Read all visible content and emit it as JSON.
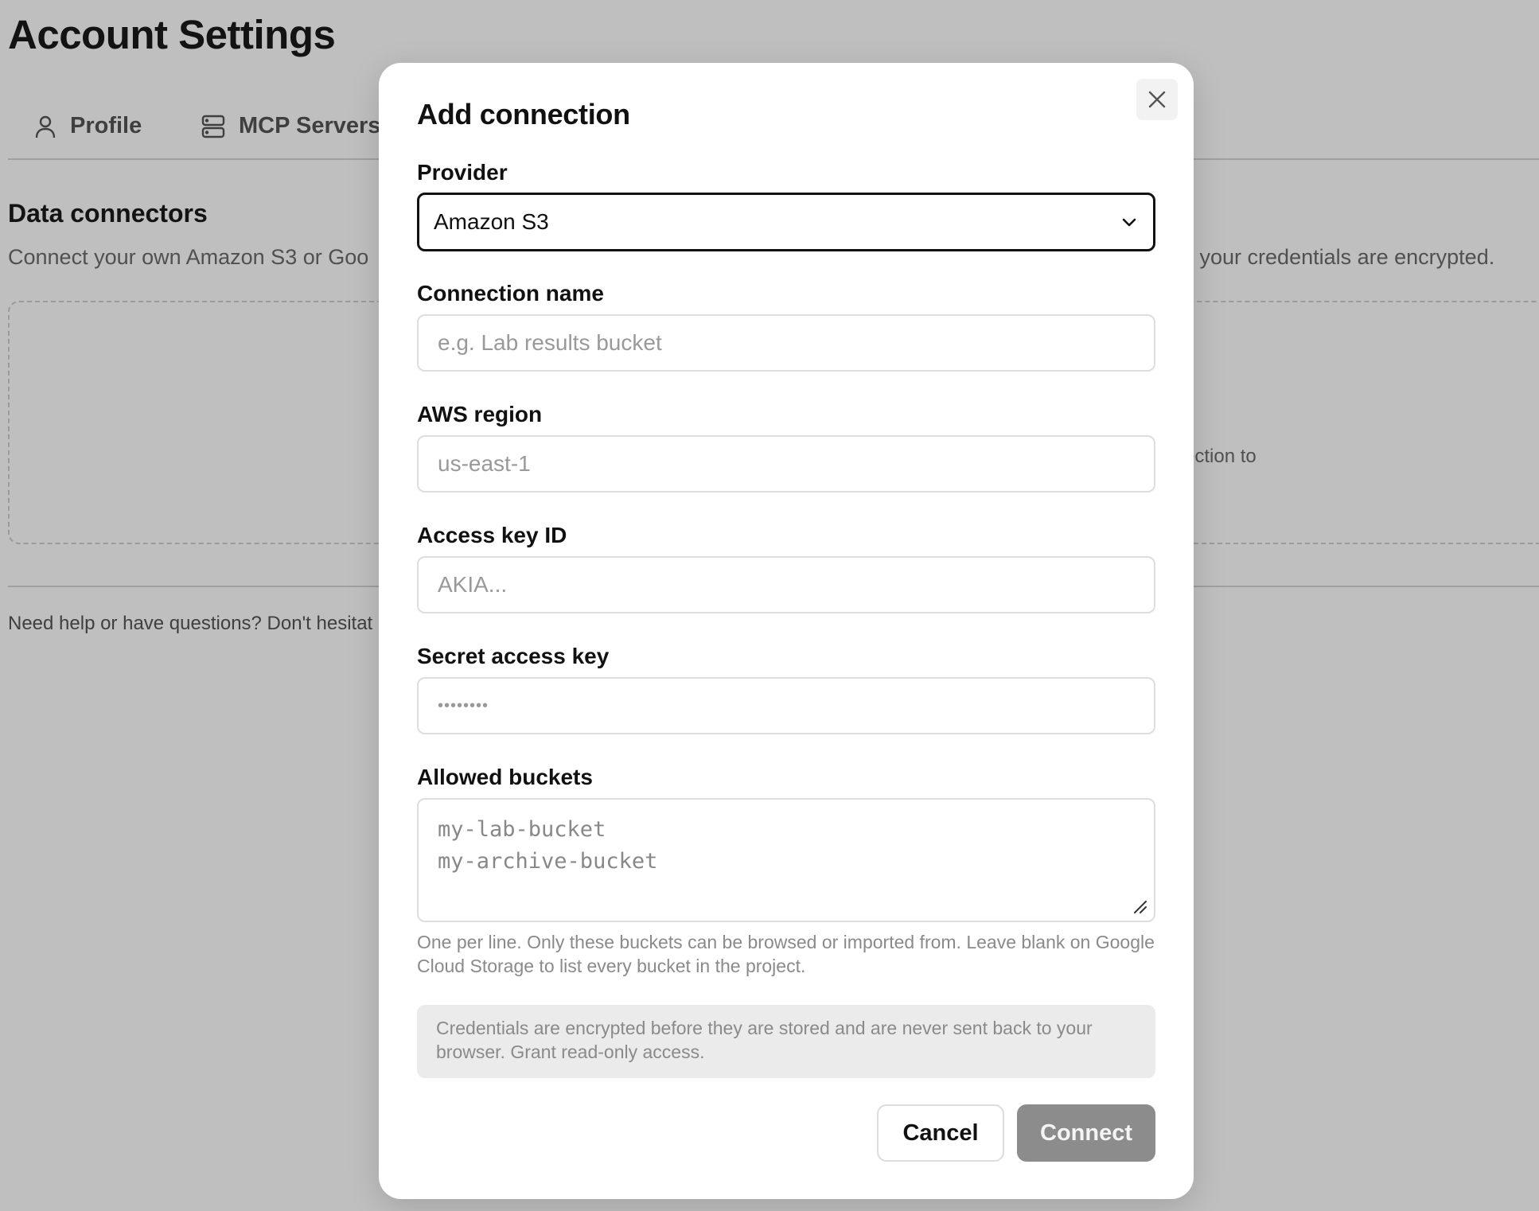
{
  "page": {
    "title": "Account Settings",
    "tabs": [
      {
        "label": "Profile",
        "icon": "user-icon"
      },
      {
        "label": "MCP Servers",
        "icon": "server-icon"
      }
    ],
    "section_title": "Data connectors",
    "section_desc_left": "Connect your own Amazon S3 or Goo",
    "section_desc_right": "d your credentials are encrypted.",
    "empty_state_fragment": "ection to",
    "help_text": "Need help or have questions? Don't hesitat"
  },
  "modal": {
    "title": "Add connection",
    "close_icon": "close-icon",
    "provider": {
      "label": "Provider",
      "value": "Amazon S3"
    },
    "connection_name": {
      "label": "Connection name",
      "placeholder": "e.g. Lab results bucket"
    },
    "aws_region": {
      "label": "AWS region",
      "placeholder": "us-east-1"
    },
    "access_key_id": {
      "label": "Access key ID",
      "placeholder": "AKIA..."
    },
    "secret_access_key": {
      "label": "Secret access key",
      "placeholder": "••••••••"
    },
    "allowed_buckets": {
      "label": "Allowed buckets",
      "placeholder_line1": "my-lab-bucket",
      "placeholder_line2": "my-archive-bucket",
      "hint": "One per line. Only these buckets can be browsed or imported from. Leave blank on Google Cloud Storage to list every bucket in the project."
    },
    "notice": "Credentials are encrypted before they are stored and are never sent back to your browser. Grant read-only access.",
    "cancel_label": "Cancel",
    "connect_label": "Connect"
  },
  "colors": {
    "overlay": "#bfbfbf",
    "connect_button_disabled": "#8c8c8c",
    "notice_bg": "#ebebeb"
  }
}
